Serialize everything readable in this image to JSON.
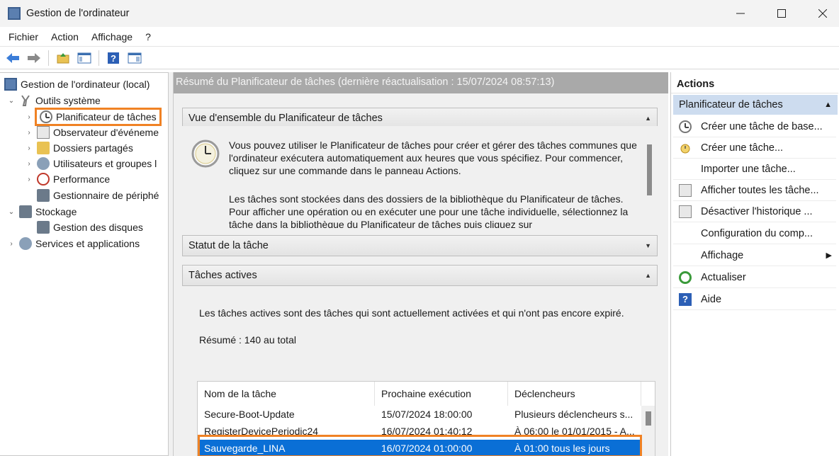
{
  "window": {
    "title": "Gestion de l'ordinateur",
    "minimize": "—",
    "maximize": "☐",
    "close": "✕"
  },
  "menu": [
    "Fichier",
    "Action",
    "Affichage",
    "?"
  ],
  "toolbar": {
    "icons": [
      "back-arrow-icon",
      "forward-arrow-icon",
      "up-folder-icon",
      "show-hide-tree-icon",
      "help-icon",
      "show-hide-action-pane-icon"
    ]
  },
  "tree": {
    "root": "Gestion de l'ordinateur (local)",
    "outils": "Outils système",
    "planificateur": "Planificateur de tâches",
    "observateur": "Observateur d'événeme",
    "dossiers": "Dossiers partagés",
    "utilisateurs": "Utilisateurs et groupes l",
    "performance": "Performance",
    "gestionnaire": "Gestionnaire de périphé",
    "stockage": "Stockage",
    "disques": "Gestion des disques",
    "services": "Services et applications"
  },
  "center": {
    "header": "Résumé du Planificateur de tâches (dernière réactualisation : 15/07/2024 08:57:13)",
    "overview_title": "Vue d'ensemble du Planificateur de tâches",
    "overview_p1": "Vous pouvez utiliser le Planificateur de tâches pour créer et gérer des tâches communes que l'ordinateur exécutera automatiquement aux heures que vous spécifiez. Pour commencer, cliquez sur une commande dans le panneau Actions.",
    "overview_p2": "Les tâches sont stockées dans des dossiers de la bibliothèque du Planificateur de tâches. Pour afficher une opération ou en exécuter une pour une tâche individuelle, sélectionnez la tâche dans la bibliothèque du Planificateur de tâches puis cliquez sur",
    "status_title": "Statut de la tâche",
    "active_title": "Tâches actives",
    "active_desc": "Les tâches actives sont des tâches qui sont actuellement activées et qui n'ont pas encore expiré.",
    "summary": "Résumé : 140 au total"
  },
  "table": {
    "columns": [
      "Nom de la tâche",
      "Prochaine exécution",
      "Déclencheurs"
    ],
    "rows": [
      [
        "Secure-Boot-Update",
        "15/07/2024 18:00:00",
        "Plusieurs déclencheurs s..."
      ],
      [
        "RegisterDevicePeriodic24",
        "16/07/2024 01:40:12",
        "À 06:00 le 01/01/2015 - A..."
      ],
      [
        "Sauvegarde_LINA",
        "16/07/2024 01:00:00",
        "À 01:00 tous les jours"
      ]
    ],
    "selected_row": 2
  },
  "actions": {
    "title": "Actions",
    "group": "Planificateur de tâches",
    "items": [
      "Créer une tâche de base...",
      "Créer une tâche...",
      "Importer une tâche...",
      "Afficher toutes les tâche...",
      "Désactiver l'historique ...",
      "Configuration du comp...",
      "Affichage",
      "Actualiser",
      "Aide"
    ]
  },
  "colors": {
    "highlight_outline": "#f08224",
    "selected_row": "#0a6fd6",
    "actions_group_bg": "#cddcef",
    "center_header_bg": "#a9a9a9"
  }
}
